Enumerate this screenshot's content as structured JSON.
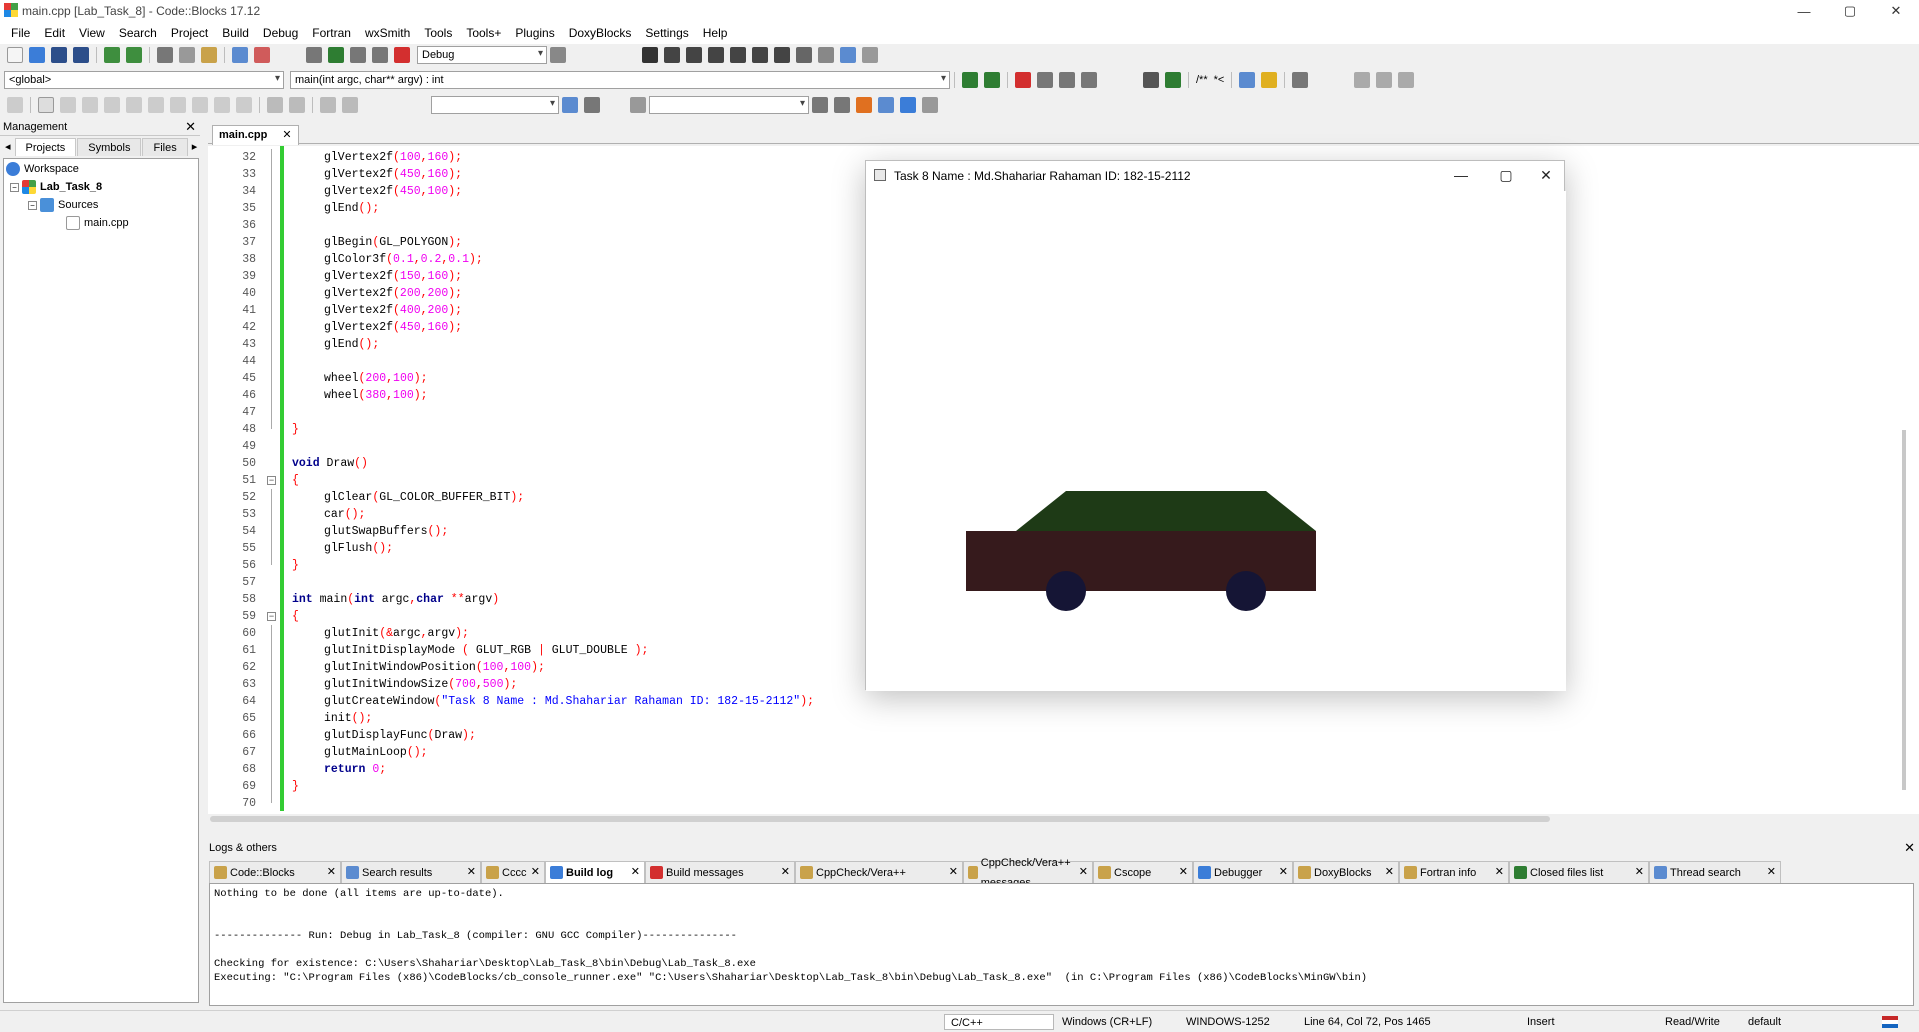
{
  "window": {
    "title": "main.cpp [Lab_Task_8] - Code::Blocks 17.12",
    "minimize": "—",
    "maximize": "▢",
    "close": "✕"
  },
  "menu": [
    "File",
    "Edit",
    "View",
    "Search",
    "Project",
    "Build",
    "Debug",
    "Fortran",
    "wxSmith",
    "Tools",
    "Tools+",
    "Plugins",
    "DoxyBlocks",
    "Settings",
    "Help"
  ],
  "toolbar": {
    "build_target": "Debug",
    "scope": "<global>",
    "function": "main(int argc, char** argv) : int",
    "doxy_comment": "/**",
    "doxy_line": "*<"
  },
  "management": {
    "title": "Management",
    "close": "✕",
    "tabs": [
      "Projects",
      "Symbols",
      "Files"
    ],
    "tree": {
      "workspace": "Workspace",
      "project": "Lab_Task_8",
      "folder": "Sources",
      "file": "main.cpp"
    }
  },
  "editor": {
    "tab_label": "main.cpp",
    "tab_close": "✕",
    "lines": [
      {
        "n": "32",
        "indent": 4,
        "parts": [
          [
            "t",
            "glVertex2f"
          ],
          [
            "o",
            "("
          ],
          [
            "n",
            "100"
          ],
          [
            "o",
            ","
          ],
          [
            "n",
            "160"
          ],
          [
            "o",
            ");"
          ]
        ]
      },
      {
        "n": "33",
        "indent": 4,
        "parts": [
          [
            "t",
            "glVertex2f"
          ],
          [
            "o",
            "("
          ],
          [
            "n",
            "450"
          ],
          [
            "o",
            ","
          ],
          [
            "n",
            "160"
          ],
          [
            "o",
            ");"
          ]
        ]
      },
      {
        "n": "34",
        "indent": 4,
        "parts": [
          [
            "t",
            "glVertex2f"
          ],
          [
            "o",
            "("
          ],
          [
            "n",
            "450"
          ],
          [
            "o",
            ","
          ],
          [
            "n",
            "100"
          ],
          [
            "o",
            ");"
          ]
        ]
      },
      {
        "n": "35",
        "indent": 4,
        "parts": [
          [
            "t",
            "glEnd"
          ],
          [
            "o",
            "();"
          ]
        ]
      },
      {
        "n": "36",
        "indent": 0,
        "parts": []
      },
      {
        "n": "37",
        "indent": 4,
        "parts": [
          [
            "t",
            "glBegin"
          ],
          [
            "o",
            "("
          ],
          [
            "t",
            "GL_POLYGON"
          ],
          [
            "o",
            ");"
          ]
        ]
      },
      {
        "n": "38",
        "indent": 4,
        "parts": [
          [
            "t",
            "glColor3f"
          ],
          [
            "o",
            "("
          ],
          [
            "n",
            "0.1"
          ],
          [
            "o",
            ","
          ],
          [
            "n",
            "0.2"
          ],
          [
            "o",
            ","
          ],
          [
            "n",
            "0.1"
          ],
          [
            "o",
            ");"
          ]
        ]
      },
      {
        "n": "39",
        "indent": 4,
        "parts": [
          [
            "t",
            "glVertex2f"
          ],
          [
            "o",
            "("
          ],
          [
            "n",
            "150"
          ],
          [
            "o",
            ","
          ],
          [
            "n",
            "160"
          ],
          [
            "o",
            ");"
          ]
        ]
      },
      {
        "n": "40",
        "indent": 4,
        "parts": [
          [
            "t",
            "glVertex2f"
          ],
          [
            "o",
            "("
          ],
          [
            "n",
            "200"
          ],
          [
            "o",
            ","
          ],
          [
            "n",
            "200"
          ],
          [
            "o",
            ");"
          ]
        ]
      },
      {
        "n": "41",
        "indent": 4,
        "parts": [
          [
            "t",
            "glVertex2f"
          ],
          [
            "o",
            "("
          ],
          [
            "n",
            "400"
          ],
          [
            "o",
            ","
          ],
          [
            "n",
            "200"
          ],
          [
            "o",
            ");"
          ]
        ]
      },
      {
        "n": "42",
        "indent": 4,
        "parts": [
          [
            "t",
            "glVertex2f"
          ],
          [
            "o",
            "("
          ],
          [
            "n",
            "450"
          ],
          [
            "o",
            ","
          ],
          [
            "n",
            "160"
          ],
          [
            "o",
            ");"
          ]
        ]
      },
      {
        "n": "43",
        "indent": 4,
        "parts": [
          [
            "t",
            "glEnd"
          ],
          [
            "o",
            "();"
          ]
        ]
      },
      {
        "n": "44",
        "indent": 0,
        "parts": []
      },
      {
        "n": "45",
        "indent": 4,
        "parts": [
          [
            "t",
            "wheel"
          ],
          [
            "o",
            "("
          ],
          [
            "n",
            "200"
          ],
          [
            "o",
            ","
          ],
          [
            "n",
            "100"
          ],
          [
            "o",
            ");"
          ]
        ]
      },
      {
        "n": "46",
        "indent": 4,
        "parts": [
          [
            "t",
            "wheel"
          ],
          [
            "o",
            "("
          ],
          [
            "n",
            "380"
          ],
          [
            "o",
            ","
          ],
          [
            "n",
            "100"
          ],
          [
            "o",
            ");"
          ]
        ]
      },
      {
        "n": "47",
        "indent": 0,
        "parts": []
      },
      {
        "n": "48",
        "indent": 0,
        "parts": [
          [
            "o",
            "}"
          ]
        ]
      },
      {
        "n": "49",
        "indent": 0,
        "parts": []
      },
      {
        "n": "50",
        "indent": 0,
        "parts": [
          [
            "k",
            "void"
          ],
          [
            "t",
            " Draw"
          ],
          [
            "o",
            "()"
          ]
        ]
      },
      {
        "n": "51",
        "indent": 0,
        "parts": [
          [
            "o",
            "{"
          ]
        ]
      },
      {
        "n": "52",
        "indent": 4,
        "parts": [
          [
            "t",
            "glClear"
          ],
          [
            "o",
            "("
          ],
          [
            "t",
            "GL_COLOR_BUFFER_BIT"
          ],
          [
            "o",
            ");"
          ]
        ]
      },
      {
        "n": "53",
        "indent": 4,
        "parts": [
          [
            "t",
            "car"
          ],
          [
            "o",
            "();"
          ]
        ]
      },
      {
        "n": "54",
        "indent": 4,
        "parts": [
          [
            "t",
            "glutSwapBuffers"
          ],
          [
            "o",
            "();"
          ]
        ]
      },
      {
        "n": "55",
        "indent": 4,
        "parts": [
          [
            "t",
            "glFlush"
          ],
          [
            "o",
            "();"
          ]
        ]
      },
      {
        "n": "56",
        "indent": 0,
        "parts": [
          [
            "o",
            "}"
          ]
        ]
      },
      {
        "n": "57",
        "indent": 0,
        "parts": []
      },
      {
        "n": "58",
        "indent": 0,
        "parts": [
          [
            "k",
            "int"
          ],
          [
            "t",
            " main"
          ],
          [
            "o",
            "("
          ],
          [
            "k",
            "int"
          ],
          [
            "t",
            " argc"
          ],
          [
            "o",
            ","
          ],
          [
            "k",
            "char"
          ],
          [
            "t",
            " "
          ],
          [
            "o",
            "**"
          ],
          [
            "t",
            "argv"
          ],
          [
            "o",
            ")"
          ]
        ]
      },
      {
        "n": "59",
        "indent": 0,
        "parts": [
          [
            "o",
            "{"
          ]
        ]
      },
      {
        "n": "60",
        "indent": 4,
        "parts": [
          [
            "t",
            "glutInit"
          ],
          [
            "o",
            "(&"
          ],
          [
            "t",
            "argc"
          ],
          [
            "o",
            ","
          ],
          [
            "t",
            "argv"
          ],
          [
            "o",
            ");"
          ]
        ]
      },
      {
        "n": "61",
        "indent": 4,
        "parts": [
          [
            "t",
            "glutInitDisplayMode"
          ],
          [
            "t",
            " "
          ],
          [
            "o",
            "("
          ],
          [
            "t",
            " GLUT_RGB "
          ],
          [
            "o",
            "|"
          ],
          [
            "t",
            " GLUT_DOUBLE "
          ],
          [
            "o",
            ");"
          ]
        ]
      },
      {
        "n": "62",
        "indent": 4,
        "parts": [
          [
            "t",
            "glutInitWindowPosition"
          ],
          [
            "o",
            "("
          ],
          [
            "n",
            "100"
          ],
          [
            "o",
            ","
          ],
          [
            "n",
            "100"
          ],
          [
            "o",
            ");"
          ]
        ]
      },
      {
        "n": "63",
        "indent": 4,
        "parts": [
          [
            "t",
            "glutInitWindowSize"
          ],
          [
            "o",
            "("
          ],
          [
            "n",
            "700"
          ],
          [
            "o",
            ","
          ],
          [
            "n",
            "500"
          ],
          [
            "o",
            ");"
          ]
        ]
      },
      {
        "n": "64",
        "indent": 4,
        "parts": [
          [
            "t",
            "glutCreateWindow"
          ],
          [
            "o",
            "("
          ],
          [
            "s",
            "\"Task 8 Name : Md.Shahariar Rahaman ID: 182-15-2112\""
          ],
          [
            "o",
            ");"
          ]
        ]
      },
      {
        "n": "65",
        "indent": 4,
        "parts": [
          [
            "t",
            "init"
          ],
          [
            "o",
            "();"
          ]
        ]
      },
      {
        "n": "66",
        "indent": 4,
        "parts": [
          [
            "t",
            "glutDisplayFunc"
          ],
          [
            "o",
            "("
          ],
          [
            "t",
            "Draw"
          ],
          [
            "o",
            ");"
          ]
        ]
      },
      {
        "n": "67",
        "indent": 4,
        "parts": [
          [
            "t",
            "glutMainLoop"
          ],
          [
            "o",
            "();"
          ]
        ]
      },
      {
        "n": "68",
        "indent": 4,
        "parts": [
          [
            "k",
            "return"
          ],
          [
            "t",
            " "
          ],
          [
            "n",
            "0"
          ],
          [
            "o",
            ";"
          ]
        ]
      },
      {
        "n": "69",
        "indent": 0,
        "parts": [
          [
            "o",
            "}"
          ]
        ]
      },
      {
        "n": "70",
        "indent": 0,
        "parts": []
      }
    ]
  },
  "gl_window": {
    "title": "Task 8 Name : Md.Shahariar Rahaman ID: 182-15-2112",
    "minimize": "—",
    "maximize": "▢",
    "close": "✕",
    "roof_color": "#1e3a16",
    "body_color": "#361a1c",
    "wheel_color": "#151535"
  },
  "logs": {
    "title": "Logs & others",
    "close": "✕",
    "tabs": [
      {
        "label": "Code::Blocks",
        "icon": "doc-icon",
        "active": false
      },
      {
        "label": "Search results",
        "icon": "search-icon",
        "active": false
      },
      {
        "label": "Cccc",
        "icon": "doc-icon",
        "active": false
      },
      {
        "label": "Build log",
        "icon": "gear-icon",
        "active": true
      },
      {
        "label": "Build messages",
        "icon": "flag-icon",
        "active": false
      },
      {
        "label": "CppCheck/Vera++",
        "icon": "doc-icon",
        "active": false
      },
      {
        "label": "CppCheck/Vera++ messages",
        "icon": "doc-icon",
        "active": false
      },
      {
        "label": "Cscope",
        "icon": "doc-icon",
        "active": false
      },
      {
        "label": "Debugger",
        "icon": "gear-icon",
        "active": false
      },
      {
        "label": "DoxyBlocks",
        "icon": "doc-icon",
        "active": false
      },
      {
        "label": "Fortran info",
        "icon": "doc-icon",
        "active": false
      },
      {
        "label": "Closed files list",
        "icon": "check-icon",
        "active": false
      },
      {
        "label": "Thread search",
        "icon": "search-icon",
        "active": false
      }
    ],
    "lines": [
      "Nothing to be done (all items are up-to-date).",
      "",
      "",
      "-------------- Run: Debug in Lab_Task_8 (compiler: GNU GCC Compiler)---------------",
      "",
      "Checking for existence: C:\\Users\\Shahariar\\Desktop\\Lab_Task_8\\bin\\Debug\\Lab_Task_8.exe",
      "Executing: \"C:\\Program Files (x86)\\CodeBlocks/cb_console_runner.exe\" \"C:\\Users\\Shahariar\\Desktop\\Lab_Task_8\\bin\\Debug\\Lab_Task_8.exe\"  (in C:\\Program Files (x86)\\CodeBlocks\\MinGW\\bin)"
    ]
  },
  "statusbar": {
    "language": "C/C++",
    "line_endings": "Windows (CR+LF)",
    "encoding": "WINDOWS-1252",
    "position": "Line 64, Col 72, Pos 1465",
    "mode": "Insert",
    "access": "Read/Write",
    "profile": "default"
  }
}
